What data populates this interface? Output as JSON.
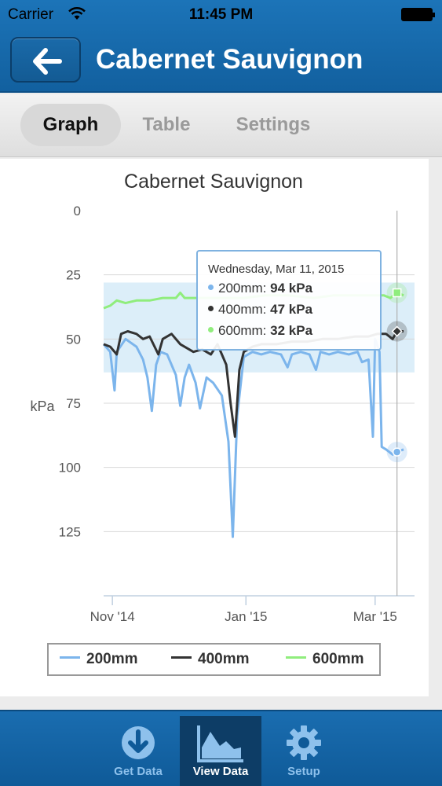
{
  "status": {
    "carrier": "Carrier",
    "time": "11:45 PM"
  },
  "nav": {
    "title": "Cabernet Sauvignon",
    "back_icon": "arrow-left-icon"
  },
  "segments": [
    {
      "label": "Graph",
      "active": true
    },
    {
      "label": "Table",
      "active": false
    },
    {
      "label": "Settings",
      "active": false
    }
  ],
  "tooltip": {
    "date": "Wednesday, Mar 11, 2015",
    "rows": [
      {
        "series": "200mm:",
        "value": "94 kPa"
      },
      {
        "series": "400mm:",
        "value": "47 kPa"
      },
      {
        "series": "600mm:",
        "value": "32 kPa"
      }
    ]
  },
  "legend": [
    {
      "label": "200mm"
    },
    {
      "label": "400mm"
    },
    {
      "label": "600mm"
    }
  ],
  "tabs": [
    {
      "label": "Get Data",
      "icon": "download-icon",
      "active": false
    },
    {
      "label": "View Data",
      "icon": "area-chart-icon",
      "active": true
    },
    {
      "label": "Setup",
      "icon": "gear-icon",
      "active": false
    }
  ],
  "colors": {
    "s200": "#7cb5ec",
    "s400": "#333333",
    "s600": "#90ed7d",
    "band": "#d6ebf8",
    "accent": "#1a6db0"
  },
  "chart_data": {
    "type": "line",
    "title": "Cabernet Sauvignon",
    "ylabel": "kPa",
    "xlabel": "",
    "yticks": [
      "0",
      "25",
      "50",
      "75",
      "100",
      "125"
    ],
    "ylim": [
      0,
      150
    ],
    "y_reversed": true,
    "xlim": [
      "2014-10-28",
      "2015-03-19"
    ],
    "xticks": [
      {
        "date": "2014-11-01",
        "label": "Nov '14"
      },
      {
        "date": "2015-01-01",
        "label": "Jan '15"
      },
      {
        "date": "2015-03-01",
        "label": "Mar '15"
      }
    ],
    "band": [
      28,
      63
    ],
    "crosshair_date": "2015-03-11",
    "grid": true,
    "legend_position": "bottom",
    "series": [
      {
        "name": "200mm",
        "points": [
          [
            "2014-10-28",
            52
          ],
          [
            "2014-10-31",
            55
          ],
          [
            "2014-11-02",
            70
          ],
          [
            "2014-11-03",
            55
          ],
          [
            "2014-11-07",
            50
          ],
          [
            "2014-11-12",
            53
          ],
          [
            "2014-11-15",
            58
          ],
          [
            "2014-11-17",
            65
          ],
          [
            "2014-11-19",
            78
          ],
          [
            "2014-11-21",
            60
          ],
          [
            "2014-11-23",
            55
          ],
          [
            "2014-11-26",
            56
          ],
          [
            "2014-11-30",
            64
          ],
          [
            "2014-12-02",
            76
          ],
          [
            "2014-12-04",
            65
          ],
          [
            "2014-12-06",
            60
          ],
          [
            "2014-12-09",
            67
          ],
          [
            "2014-12-11",
            77
          ],
          [
            "2014-12-14",
            65
          ],
          [
            "2014-12-17",
            67
          ],
          [
            "2014-12-21",
            72
          ],
          [
            "2014-12-24",
            90
          ],
          [
            "2014-12-26",
            127
          ],
          [
            "2014-12-28",
            80
          ],
          [
            "2014-12-31",
            57
          ],
          [
            "2015-01-04",
            55
          ],
          [
            "2015-01-08",
            56
          ],
          [
            "2015-01-12",
            55
          ],
          [
            "2015-01-17",
            56
          ],
          [
            "2015-01-20",
            61
          ],
          [
            "2015-01-22",
            56
          ],
          [
            "2015-01-26",
            55
          ],
          [
            "2015-01-30",
            56
          ],
          [
            "2015-02-02",
            62
          ],
          [
            "2015-02-04",
            55
          ],
          [
            "2015-02-08",
            56
          ],
          [
            "2015-02-12",
            55
          ],
          [
            "2015-02-17",
            56
          ],
          [
            "2015-02-21",
            55
          ],
          [
            "2015-02-23",
            59
          ],
          [
            "2015-02-26",
            58
          ],
          [
            "2015-02-28",
            88
          ],
          [
            "2015-03-01",
            50
          ],
          [
            "2015-03-03",
            55
          ],
          [
            "2015-03-04",
            92
          ],
          [
            "2015-03-06",
            93
          ],
          [
            "2015-03-09",
            95
          ],
          [
            "2015-03-11",
            94
          ],
          [
            "2015-03-14",
            93
          ]
        ]
      },
      {
        "name": "400mm",
        "points": [
          [
            "2014-10-28",
            52
          ],
          [
            "2014-10-31",
            53
          ],
          [
            "2014-11-03",
            56
          ],
          [
            "2014-11-05",
            48
          ],
          [
            "2014-11-08",
            47
          ],
          [
            "2014-11-12",
            48
          ],
          [
            "2014-11-15",
            50
          ],
          [
            "2014-11-18",
            49
          ],
          [
            "2014-11-22",
            56
          ],
          [
            "2014-11-24",
            50
          ],
          [
            "2014-11-28",
            48
          ],
          [
            "2014-12-02",
            52
          ],
          [
            "2014-12-06",
            54
          ],
          [
            "2014-12-08",
            55
          ],
          [
            "2014-12-12",
            54
          ],
          [
            "2014-12-16",
            56
          ],
          [
            "2014-12-19",
            52
          ],
          [
            "2014-12-23",
            60
          ],
          [
            "2014-12-25",
            75
          ],
          [
            "2014-12-27",
            88
          ],
          [
            "2014-12-29",
            62
          ],
          [
            "2014-12-31",
            55
          ],
          [
            "2015-01-04",
            53
          ],
          [
            "2015-01-08",
            52
          ],
          [
            "2015-01-15",
            52
          ],
          [
            "2015-01-22",
            51
          ],
          [
            "2015-01-29",
            51
          ],
          [
            "2015-02-05",
            50
          ],
          [
            "2015-02-12",
            50
          ],
          [
            "2015-02-20",
            49
          ],
          [
            "2015-02-26",
            49
          ],
          [
            "2015-03-02",
            48
          ],
          [
            "2015-03-06",
            48
          ],
          [
            "2015-03-09",
            50
          ],
          [
            "2015-03-11",
            47
          ],
          [
            "2015-03-14",
            47
          ]
        ]
      },
      {
        "name": "600mm",
        "points": [
          [
            "2014-10-28",
            38
          ],
          [
            "2014-10-31",
            37
          ],
          [
            "2014-11-03",
            35
          ],
          [
            "2014-11-07",
            36
          ],
          [
            "2014-11-12",
            35
          ],
          [
            "2014-11-18",
            35
          ],
          [
            "2014-11-24",
            34
          ],
          [
            "2014-11-30",
            34
          ],
          [
            "2014-12-02",
            32
          ],
          [
            "2014-12-04",
            34
          ],
          [
            "2014-12-10",
            34
          ],
          [
            "2014-12-18",
            34
          ],
          [
            "2014-12-24",
            34
          ],
          [
            "2014-12-31",
            34
          ],
          [
            "2015-01-10",
            33
          ],
          [
            "2015-01-20",
            33
          ],
          [
            "2015-02-01",
            34
          ],
          [
            "2015-02-10",
            33
          ],
          [
            "2015-02-20",
            33
          ],
          [
            "2015-03-01",
            33
          ],
          [
            "2015-03-05",
            33
          ],
          [
            "2015-03-08",
            34
          ],
          [
            "2015-03-11",
            32
          ],
          [
            "2015-03-14",
            33
          ]
        ]
      }
    ]
  }
}
